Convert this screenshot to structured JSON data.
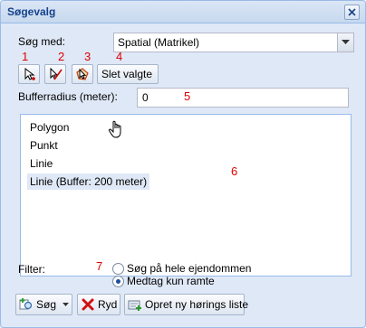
{
  "dialog": {
    "title": "Søgevalg",
    "close_icon": "close-icon"
  },
  "search": {
    "label": "Søg med:",
    "selected": "Spatial (Matrikel)"
  },
  "toolbar": {
    "point_tool": "point-select-icon",
    "line_tool": "line-select-icon",
    "polygon_tool": "polygon-select-icon",
    "clear_label": "Slet valgte"
  },
  "buffer": {
    "label": "Bufferradius (meter):",
    "value": "0"
  },
  "annotations": [
    "1",
    "2",
    "3",
    "4",
    "5",
    "6",
    "7"
  ],
  "list": {
    "items": [
      "Polygon",
      "Punkt",
      "Linie",
      "Linie (Buffer: 200 meter)"
    ],
    "selected_index": 3
  },
  "filter": {
    "label": "Filter:",
    "options": [
      "Søg på hele ejendommen",
      "Medtag kun ramte"
    ],
    "selected_index": 1
  },
  "buttons": {
    "search_label": "Søg",
    "clear_label": "Ryd",
    "create_list_label": "Opret ny hørings liste"
  },
  "colors": {
    "annotation": "#e00000",
    "title": "#15428b",
    "accent": "#99bbe8"
  }
}
